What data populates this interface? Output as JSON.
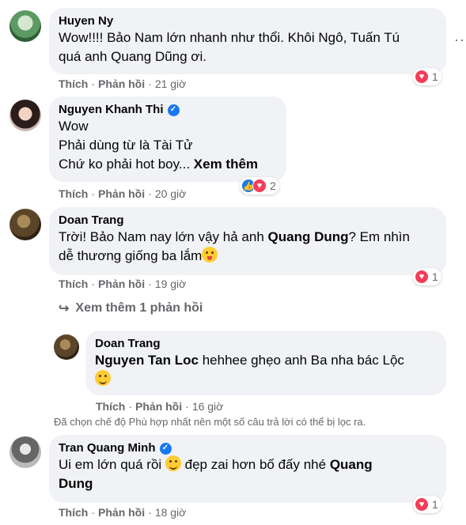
{
  "comments": [
    {
      "name": "Huyen Ny",
      "verified": false,
      "lines": [
        "Wow!!!! Bảo Nam lớn nhanh như thổi. Khôi Ngô, Tuấn Tú",
        "quá anh Quang Dũng ơi."
      ],
      "like_label": "Thích",
      "reply_label": "Phản hồi",
      "time": "21 giờ",
      "reaction_count": "1"
    },
    {
      "name": "Nguyen Khanh Thi",
      "verified": true,
      "lines": [
        "Wow",
        "Phải dùng từ là Tài Tử",
        "Chứ ko phải hot boy..."
      ],
      "see_more": "Xem thêm",
      "like_label": "Thích",
      "reply_label": "Phản hồi",
      "time": "20 giờ",
      "reaction_count": "2"
    },
    {
      "name": "Doan Trang",
      "verified": false,
      "line1_pre": "Trời! Bảo Nam nay lớn vậy hả anh ",
      "line1_tag": "Quang Dung",
      "line1_post": "? Em nhìn",
      "line2": "dễ thương giống ba lắm",
      "like_label": "Thích",
      "reply_label": "Phản hồi",
      "time": "19 giờ",
      "reaction_count": "1"
    },
    {
      "name": "Tran Quang Minh",
      "verified": true,
      "line1_pre": "Ui em lớn quá rồi ",
      "line1_mid": " đẹp zai hơn bố đấy nhé ",
      "line1_tag": "Quang",
      "line2_tag": "Dung",
      "like_label": "Thích",
      "reply_label": "Phản hồi",
      "time": "18 giờ",
      "reaction_count": "1"
    }
  ],
  "view_more_replies": "Xem thêm 1 phản hồi",
  "reply": {
    "name": "Doan Trang",
    "tag": "Nguyen Tan Loc",
    "text": " hehhee ghẹo anh Ba nha bác Lộc",
    "like_label": "Thích",
    "reply_label": "Phản hồi",
    "time": "16 giờ"
  },
  "filter_note": "Đã chọn chế độ Phù hợp nhất nên một số câu trả lời có thể bị lọc ra.",
  "colors": {
    "bubble": "#f0f2f5",
    "meta": "#65676b",
    "heart": "#f33e58",
    "like": "#1877f2"
  }
}
